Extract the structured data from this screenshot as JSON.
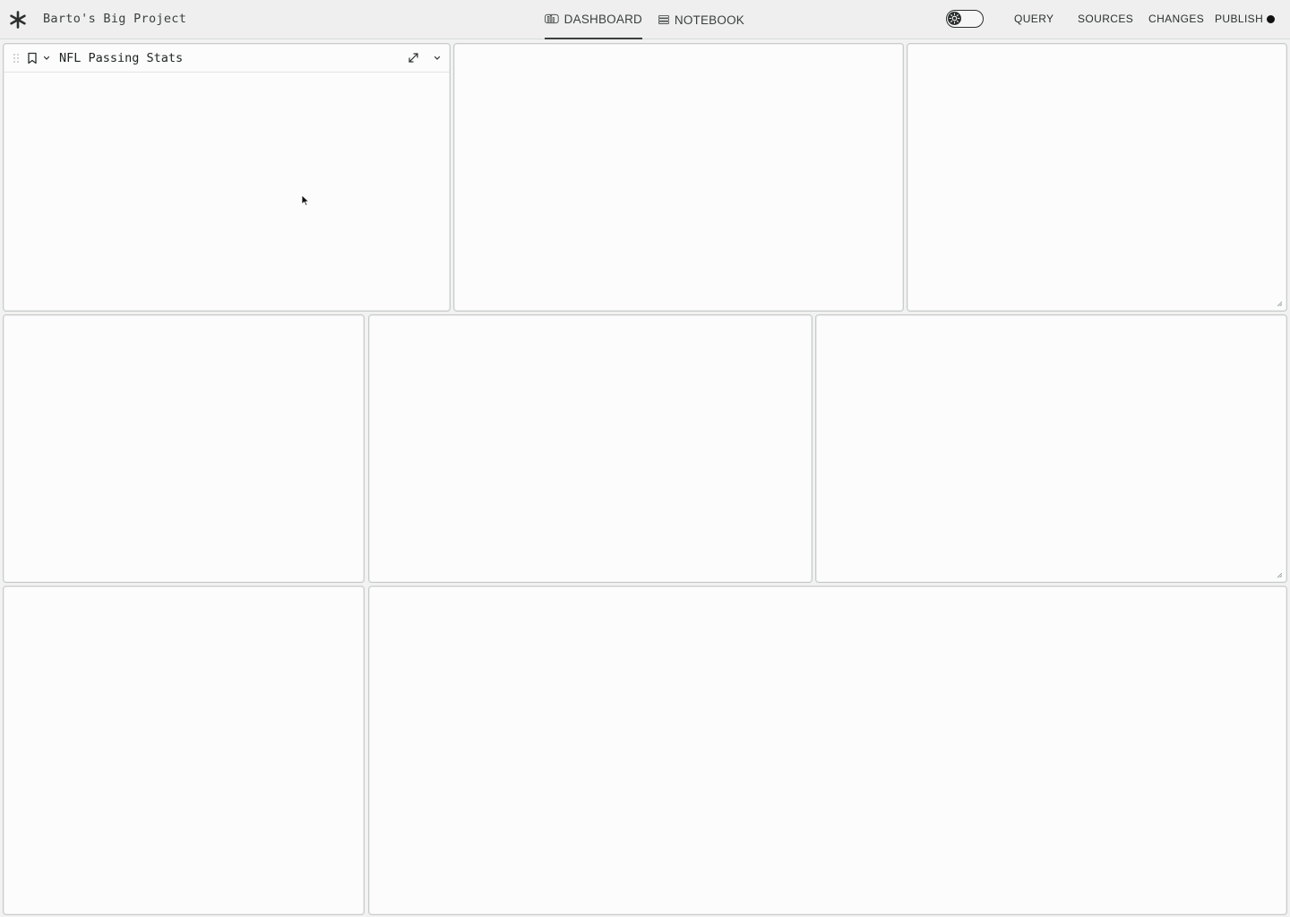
{
  "header": {
    "project_title": "Barto's Big Project",
    "tabs": [
      {
        "label": "DASHBOARD",
        "active": true
      },
      {
        "label": "NOTEBOOK",
        "active": false
      }
    ],
    "theme_toggle": {
      "state": "off"
    },
    "nav": {
      "query": "QUERY",
      "sources": "SOURCES",
      "changes": "CHANGES",
      "publish": "PUBLISH"
    },
    "publish_status_color": "#111111"
  },
  "panels": [
    {
      "title": "NFL Passing Stats"
    }
  ],
  "icons": {
    "logo": "asterisk-logo-icon",
    "dashboard_tab": "bar-chart-icon",
    "notebook_tab": "stacked-rows-icon",
    "theme_toggle": "sun-icon",
    "panel_drag": "drag-handle-icon",
    "panel_bookmark": "bookmark-icon",
    "panel_expand": "expand-icon",
    "panel_menu": "chevron-down-icon"
  },
  "colors": {
    "background": "#f1f2f1",
    "panel": "#fbfcfb",
    "border": "#c9cccb",
    "text": "#2b2f2e"
  }
}
